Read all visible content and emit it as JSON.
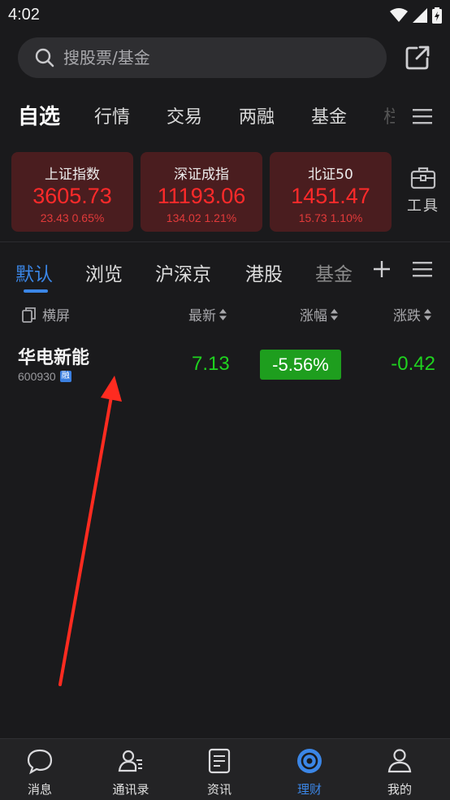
{
  "status_bar": {
    "time": "4:02"
  },
  "search": {
    "placeholder": "搜股票/基金"
  },
  "top_tabs": [
    "自选",
    "行情",
    "交易",
    "两融",
    "基金",
    "栏"
  ],
  "indices": [
    {
      "name": "上证指数",
      "value": "3605.73",
      "change": "23.43  0.65%"
    },
    {
      "name": "深证成指",
      "value": "11193.06",
      "change": "134.02  1.21%"
    },
    {
      "name": "北证50",
      "value": "1451.47",
      "change": "15.73  1.10%"
    }
  ],
  "tools": {
    "label": "工具"
  },
  "list_tabs": [
    "默认",
    "浏览",
    "沪深京",
    "港股",
    "基金"
  ],
  "header": {
    "landscape": "横屏",
    "latest": "最新",
    "change_pct": "涨幅",
    "change": "涨跌"
  },
  "stocks": [
    {
      "name": "华电新能",
      "code": "600930",
      "badge": "融",
      "price": "7.13",
      "change_pct": "-5.56%",
      "change": "-0.42"
    }
  ],
  "bottom_nav": [
    {
      "label": "消息",
      "icon": "message-icon"
    },
    {
      "label": "通讯录",
      "icon": "contacts-icon"
    },
    {
      "label": "资讯",
      "icon": "news-icon"
    },
    {
      "label": "理财",
      "icon": "finance-icon",
      "active": true
    },
    {
      "label": "我的",
      "icon": "profile-icon"
    }
  ],
  "colors": {
    "up": "#ff2a2a",
    "down": "#1fd31f",
    "accent": "#3b86e6",
    "background": "#1a1a1c"
  }
}
